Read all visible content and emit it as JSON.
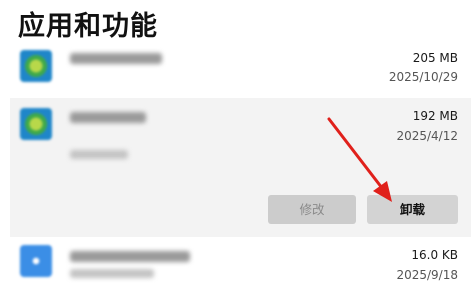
{
  "page": {
    "title": "应用和功能"
  },
  "apps": [
    {
      "size": "205 MB",
      "date": "2025/10/29"
    },
    {
      "size": "192 MB",
      "date": "2025/4/12",
      "actions": {
        "modify_label": "修改",
        "uninstall_label": "卸载"
      }
    },
    {
      "size": "16.0 KB",
      "date": "2025/9/18"
    }
  ],
  "icons": {
    "app1": "green-app-icon",
    "app2": "green-app-icon",
    "app3": "blue-app-icon"
  },
  "colors": {
    "selected_row_bg": "#f3f3f3",
    "annotation_arrow": "#e0201b"
  }
}
